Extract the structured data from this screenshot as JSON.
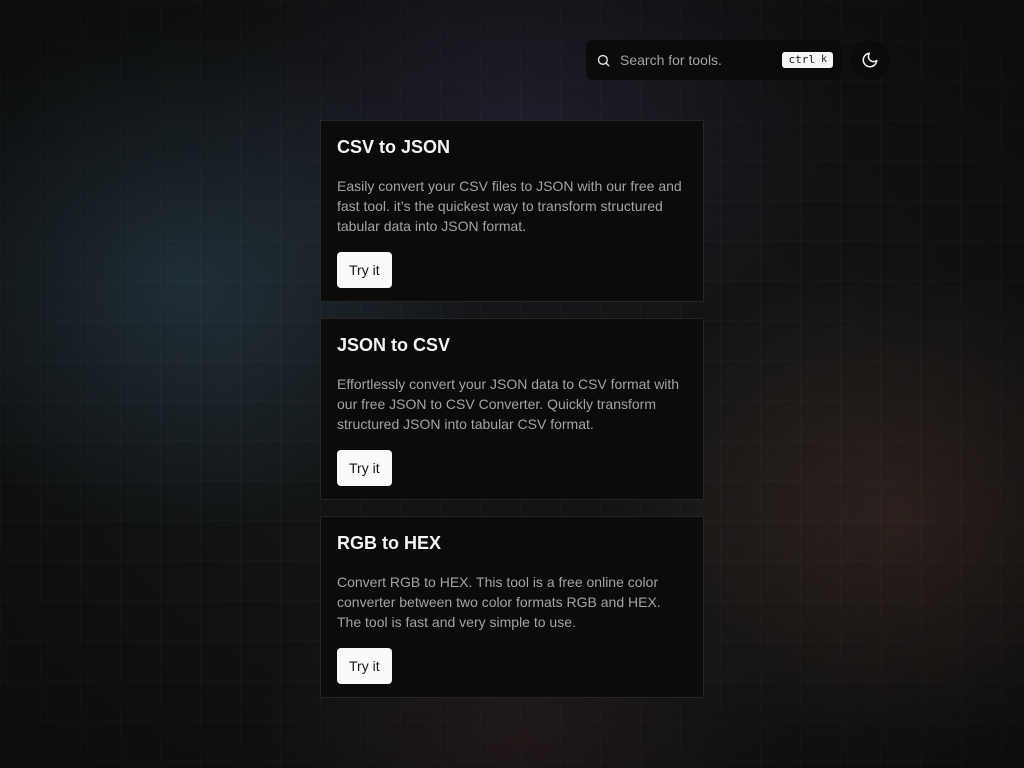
{
  "search": {
    "placeholder": "Search for tools.",
    "shortcut_modifier": "ctrl",
    "shortcut_key": "k"
  },
  "theme_toggle": {
    "icon": "moon-icon"
  },
  "tools": [
    {
      "title": "CSV to JSON",
      "description": "Easily convert your CSV files to JSON with our free and fast tool. it’s the quickest way to transform structured tabular data into JSON format.",
      "button_label": "Try it"
    },
    {
      "title": "JSON to CSV",
      "description": "Effortlessly convert your JSON data to CSV format with our free JSON to CSV Converter. Quickly transform structured JSON into tabular CSV format.",
      "button_label": "Try it"
    },
    {
      "title": "RGB to HEX",
      "description": "Convert RGB to HEX. This tool is a free online color converter between two color formats RGB and HEX. The tool is fast and very simple to use.",
      "button_label": "Try it"
    }
  ],
  "colors": {
    "card_background": "#0b0b0c",
    "button_background": "#fafafa",
    "text_muted": "#a3a3a3"
  }
}
